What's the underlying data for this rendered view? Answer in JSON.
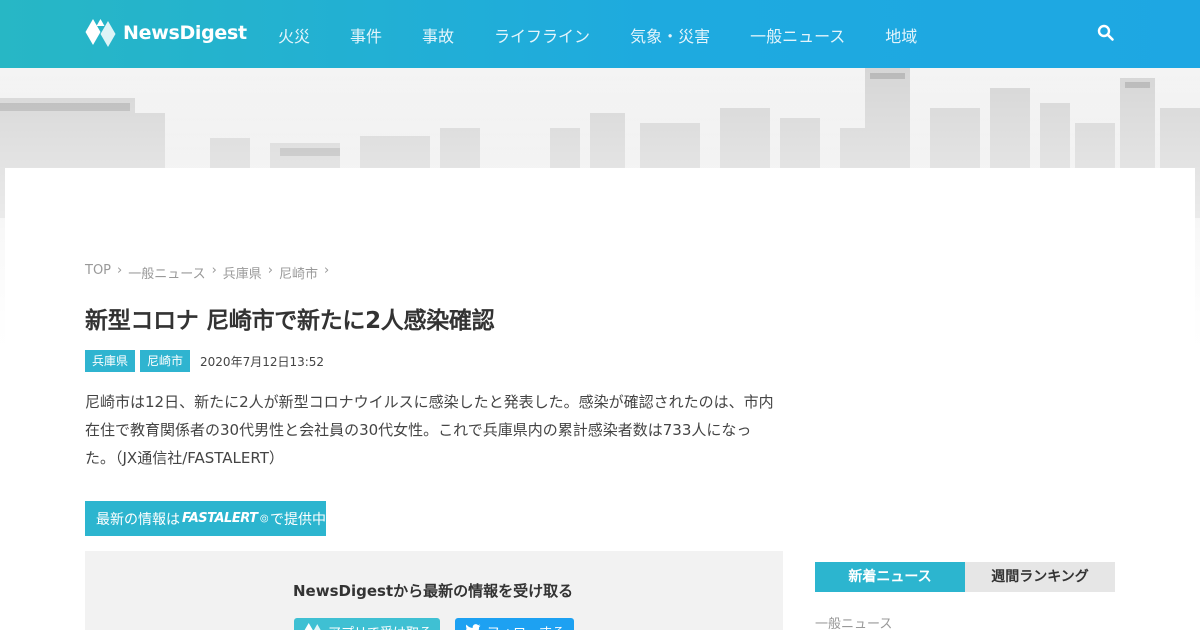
{
  "header": {
    "logo_text": "NewsDigest",
    "nav": [
      "火災",
      "事件",
      "事故",
      "ライフライン",
      "気象・災害",
      "一般ニュース",
      "地域"
    ]
  },
  "breadcrumb": [
    "TOP",
    "一般ニュース",
    "兵庫県",
    "尼崎市"
  ],
  "article": {
    "title": "新型コロナ 尼崎市で新たに2人感染確認",
    "tags": [
      "兵庫県",
      "尼崎市"
    ],
    "date": "2020年7月12日13:52",
    "body": "尼崎市は12日、新たに2人が新型コロナウイルスに感染したと発表した。感染が確認されたのは、市内在住で教育関係者の30代男性と会社員の30代女性。これで兵庫県内の累計感染者数は733人になった。（JX通信社/FASTALERT）"
  },
  "fast_button": {
    "prefix": "最新の情報は",
    "logo": "FASTALERT",
    "suffix": "で提供中"
  },
  "subscribe": {
    "title": "NewsDigestから最新の情報を受け取る",
    "app_label": "アプリで受け取る",
    "twitter_label": "フォローする"
  },
  "sidebar": {
    "tabs": [
      "新着ニュース",
      "週間ランキング"
    ],
    "category": "一般ニュース"
  },
  "colors": {
    "header_start": "#27b7c5",
    "header_end": "#1ea7e3",
    "accent": "#2cb5cf",
    "twitter": "#1da1f2"
  }
}
